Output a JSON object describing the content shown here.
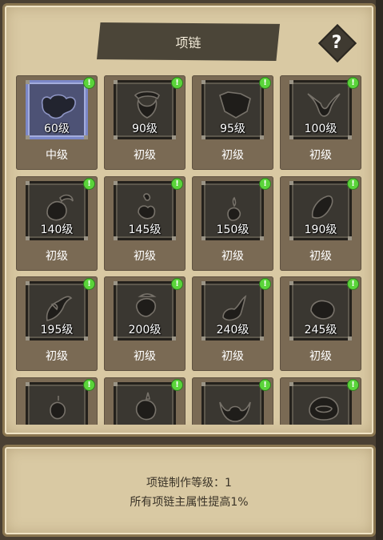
{
  "header": {
    "title": "项链",
    "help_label": "?"
  },
  "items": [
    {
      "level": "60级",
      "grade": "中级",
      "badge": "!",
      "icon": "beaded-necklace-icon",
      "selected": true
    },
    {
      "level": "90级",
      "grade": "初级",
      "badge": "!",
      "icon": "ring-necklace-icon"
    },
    {
      "level": "95级",
      "grade": "初级",
      "badge": "!",
      "icon": "collar-necklace-icon"
    },
    {
      "level": "100级",
      "grade": "初级",
      "badge": "!",
      "icon": "twisted-necklace-icon"
    },
    {
      "level": "140级",
      "grade": "初级",
      "badge": "!",
      "icon": "claw-pendant-icon"
    },
    {
      "level": "145级",
      "grade": "初级",
      "badge": "!",
      "icon": "gourd-pendant-icon"
    },
    {
      "level": "150级",
      "grade": "初级",
      "badge": "!",
      "icon": "drop-pendant-icon"
    },
    {
      "level": "190级",
      "grade": "初级",
      "badge": "!",
      "icon": "gem-pendant-icon"
    },
    {
      "level": "195级",
      "grade": "初级",
      "badge": "!",
      "icon": "fang-pendant-icon"
    },
    {
      "level": "200级",
      "grade": "初级",
      "badge": "!",
      "icon": "knot-pendant-icon"
    },
    {
      "level": "240级",
      "grade": "初级",
      "badge": "!",
      "icon": "hook-pendant-icon"
    },
    {
      "level": "245级",
      "grade": "初级",
      "badge": "!",
      "icon": "beast-pendant-icon"
    },
    {
      "level": "",
      "grade": "",
      "badge": "!",
      "icon": "orb-pendant-icon"
    },
    {
      "level": "",
      "grade": "",
      "badge": "!",
      "icon": "spiked-pendant-icon"
    },
    {
      "level": "",
      "grade": "",
      "badge": "!",
      "icon": "horned-pendant-icon"
    },
    {
      "level": "",
      "grade": "",
      "badge": "!",
      "icon": "ring-disc-icon"
    }
  ],
  "footer": {
    "craft_level": "项链制作等级：1",
    "bonus": "所有项链主属性提高1%"
  },
  "colors": {
    "panel": "#d9c9a3",
    "card": "#7a6a54",
    "slot": "#3a3731",
    "selected_slot": "#4d5275",
    "badge": "#5ad43a"
  }
}
